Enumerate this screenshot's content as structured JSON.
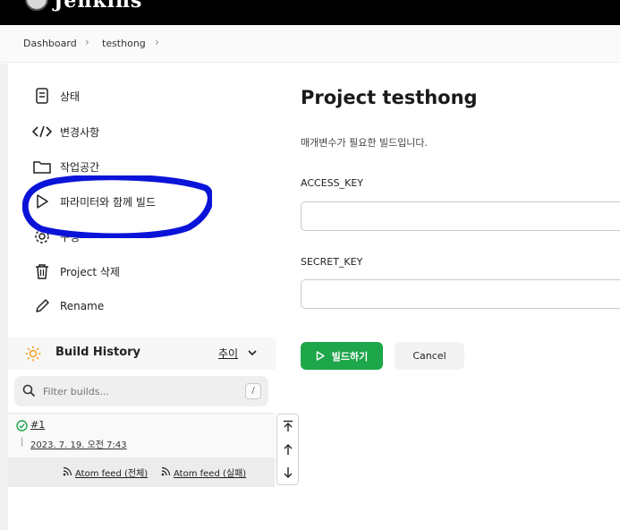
{
  "header": {
    "brand": "Jenkins"
  },
  "breadcrumb": {
    "items": [
      "Dashboard",
      "testhong"
    ],
    "separator": "›"
  },
  "sidebar": {
    "items": [
      {
        "label": "상태",
        "icon": "document-icon"
      },
      {
        "label": "변경사항",
        "icon": "code-icon"
      },
      {
        "label": "작업공간",
        "icon": "folder-icon"
      },
      {
        "label": "파라미터와 함께 빌드",
        "icon": "play-icon"
      },
      {
        "label": "구성",
        "icon": "gear-icon"
      },
      {
        "label": "Project 삭제",
        "icon": "trash-icon"
      },
      {
        "label": "Rename",
        "icon": "pencil-icon"
      }
    ]
  },
  "build_history": {
    "title": "Build History",
    "trend_label": "추이",
    "filter_placeholder": "Filter builds...",
    "filter_shortcut": "/",
    "builds": [
      {
        "number": "#1",
        "date": "2023. 7. 19. 오전 7:43",
        "status": "success"
      }
    ],
    "feed_all": "Atom feed (전체)",
    "feed_failed": "Atom feed (실패)"
  },
  "main": {
    "title": "Project testhong",
    "description": "매개변수가 필요한 빌드입니다.",
    "params": [
      {
        "label": "ACCESS_KEY",
        "value": ""
      },
      {
        "label": "SECRET_KEY",
        "value": ""
      }
    ],
    "build_button": "빌드하기",
    "cancel_button": "Cancel"
  },
  "colors": {
    "success": "#1ea64b",
    "annotation": "#0a14d8",
    "header_bg": "#000000"
  }
}
